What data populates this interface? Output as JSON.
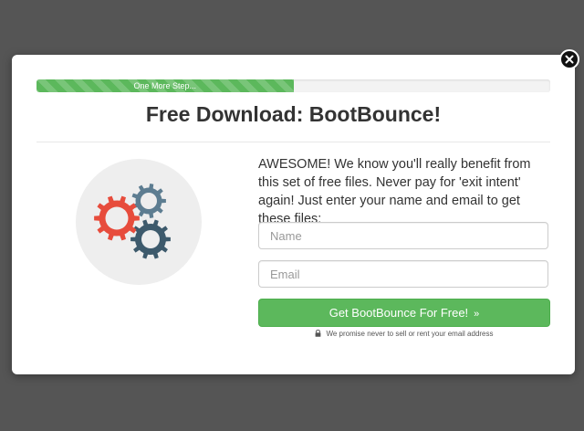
{
  "progress": {
    "label": "One More Step...",
    "percent": 50
  },
  "modal": {
    "title": "Free Download: BootBounce!",
    "pitch": "AWESOME! We know you'll really benefit from this set of free files. Never pay for 'exit intent' again! Just enter your name and email to get these files:",
    "illustration_icon": "gears-icon"
  },
  "form": {
    "name_placeholder": "Name",
    "email_placeholder": "Email",
    "submit_label": "Get BootBounce For Free!",
    "submit_icon": "double-chevron-right-icon"
  },
  "privacy": {
    "icon": "lock-icon",
    "text": "We promise never to sell or rent your email address"
  },
  "close": {
    "icon": "close-icon"
  },
  "colors": {
    "overlay": "#555555",
    "accent_green": "#5cb85c",
    "gear_red": "#e74c3c",
    "gear_blue": "#5d7d91",
    "gear_dark": "#3d5a6c",
    "circle_bg": "#eeeeee"
  }
}
